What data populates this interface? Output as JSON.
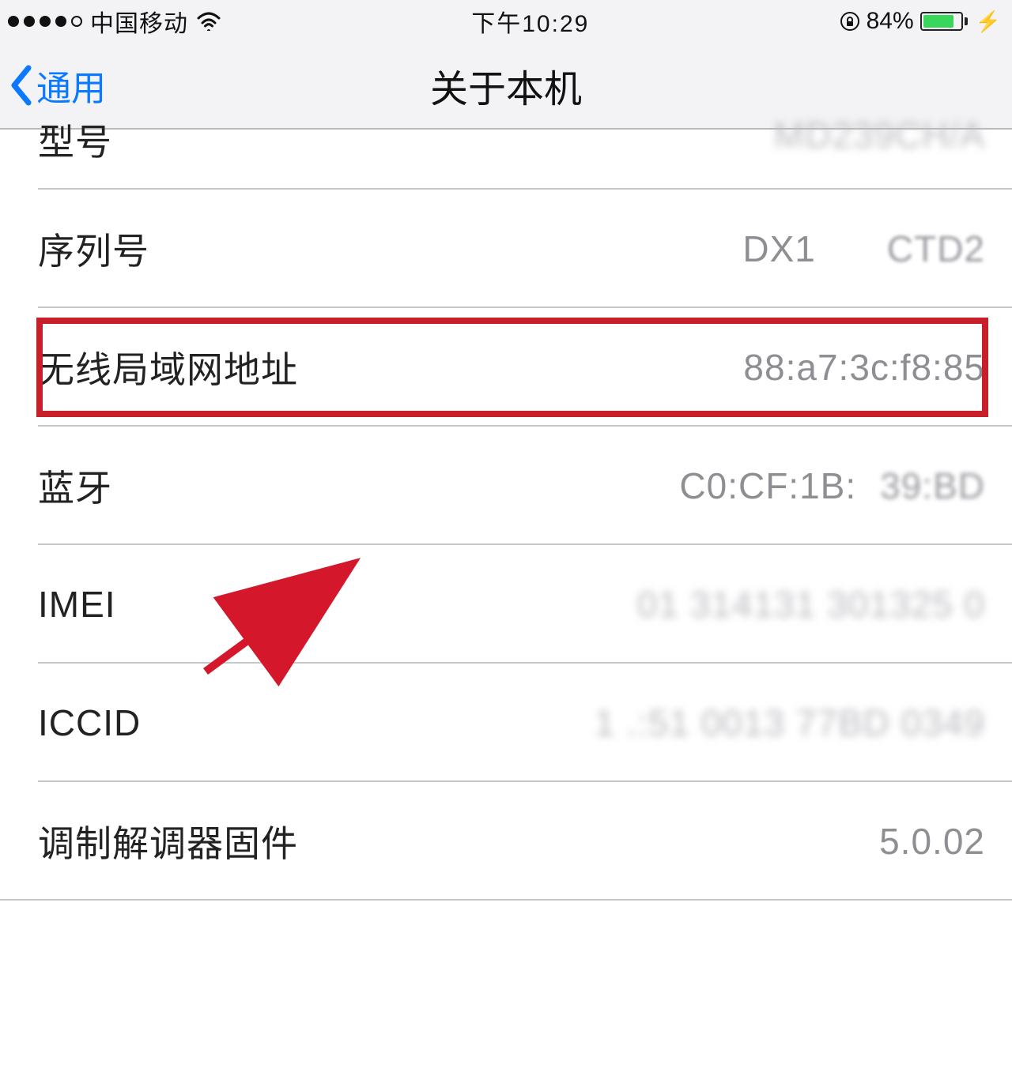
{
  "status": {
    "carrier": "中国移动",
    "time": "下午10:29",
    "battery_pct": "84%",
    "battery_fill_pct": 84
  },
  "nav": {
    "back_label": "通用",
    "title": "关于本机"
  },
  "rows": {
    "model_label": "型号",
    "model_value": "MD239CH/A",
    "serial_label": "序列号",
    "serial_value_prefix": "DX1",
    "serial_value_suffix": "CTD2",
    "wlan_label": "无线局域网地址",
    "wlan_value": "88:a7:3c:f8:85",
    "bt_label": "蓝牙",
    "bt_value_prefix": "C0:CF:1B:",
    "bt_value_suffix": "39:BD",
    "imei_label": "IMEI",
    "imei_value": "01 314131  301325 0",
    "iccid_label": "ICCID",
    "iccid_value": "1  .:51 0013 77BD 0349",
    "modem_label": "调制解调器固件",
    "modem_value": "5.0.02"
  }
}
